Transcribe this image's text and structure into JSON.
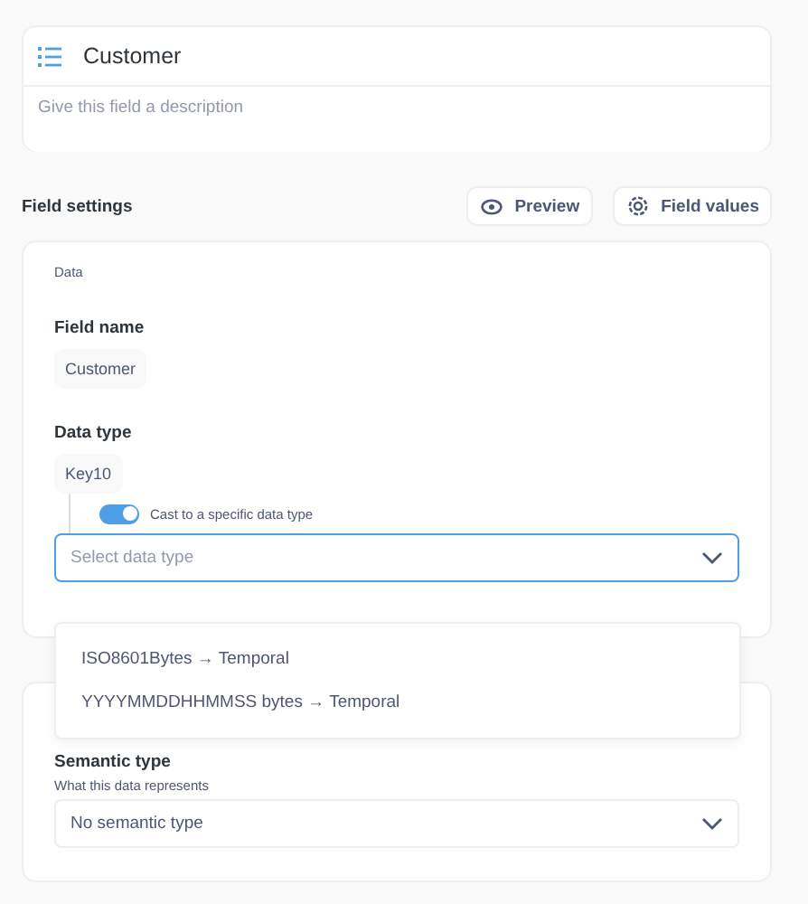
{
  "header": {
    "title": "Customer",
    "description_placeholder": "Give this field a description"
  },
  "settings": {
    "title": "Field settings",
    "buttons": [
      {
        "label": "Preview",
        "kind": "eye"
      },
      {
        "label": "Field values",
        "kind": "values"
      }
    ]
  },
  "data": {
    "section": "Data",
    "field_name_label": "Field name",
    "field_name": "Customer",
    "data_type_label": "Data type",
    "data_type": "Key10",
    "cast": {
      "label": "Cast to a specific data type",
      "on": true
    },
    "select": {
      "placeholder": "Select data type",
      "expanded": true
    },
    "options": [
      {
        "label": "ISO8601Bytes → Temporal",
        "selected": false
      },
      {
        "label": "YYYYMMDDHHMMSS bytes → Temporal",
        "selected": false
      }
    ]
  },
  "semantic": {
    "label": "Semantic type",
    "hint": "What this data represents",
    "value": "No semantic type"
  }
}
